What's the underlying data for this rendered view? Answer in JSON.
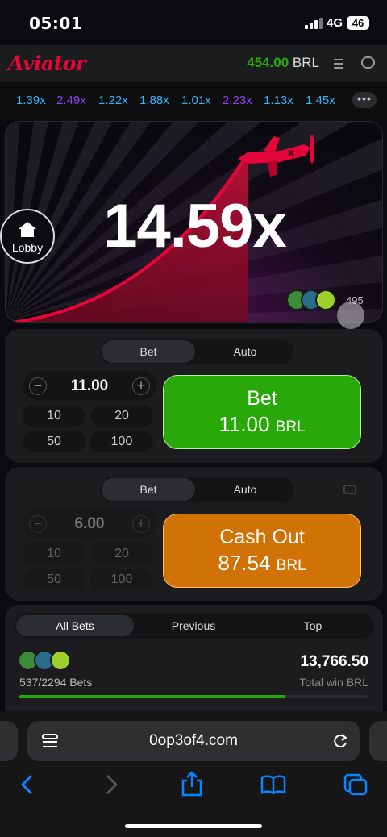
{
  "status_bar": {
    "time": "05:01",
    "network": "4G",
    "battery": "46"
  },
  "header": {
    "logo": "Aviator",
    "balance_amount": "454.00",
    "balance_currency": "BRL"
  },
  "history": {
    "multipliers": [
      {
        "value": "1.39x",
        "color": "#34b4ff"
      },
      {
        "value": "2.49x",
        "color": "#913ef8"
      },
      {
        "value": "1.22x",
        "color": "#34b4ff"
      },
      {
        "value": "1.88x",
        "color": "#34b4ff"
      },
      {
        "value": "1.01x",
        "color": "#34b4ff"
      },
      {
        "value": "2.23x",
        "color": "#913ef8"
      },
      {
        "value": "1.13x",
        "color": "#34b4ff"
      },
      {
        "value": "1.45x",
        "color": "#34b4ff"
      }
    ],
    "more_label": "•••"
  },
  "game": {
    "multiplier": "14.59x",
    "lobby_label": "Lobby",
    "players_count": "495"
  },
  "bet_panel_1": {
    "tabs": [
      "Bet",
      "Auto"
    ],
    "active_tab": "Bet",
    "amount": "11.00",
    "quick": [
      "10",
      "20",
      "50",
      "100"
    ],
    "button_line1": "Bet",
    "button_amount": "11.00",
    "button_currency": "BRL"
  },
  "bet_panel_2": {
    "tabs": [
      "Bet",
      "Auto"
    ],
    "active_tab": "Bet",
    "amount": "6.00",
    "quick": [
      "10",
      "20",
      "50",
      "100"
    ],
    "button_line1": "Cash Out",
    "button_amount": "87.54",
    "button_currency": "BRL"
  },
  "bets_list": {
    "tabs": [
      "All Bets",
      "Previous",
      "Top"
    ],
    "active_tab": "All Bets",
    "count": "537/2294",
    "count_label": "Bets",
    "total_win": "13,766.50",
    "total_win_label": "Total win BRL",
    "progress_fraction": 0.765
  },
  "safari": {
    "url": "0op3of4.com"
  },
  "colors": {
    "green": "#28a909",
    "orange": "#d07206",
    "brand_red": "#e50539"
  }
}
